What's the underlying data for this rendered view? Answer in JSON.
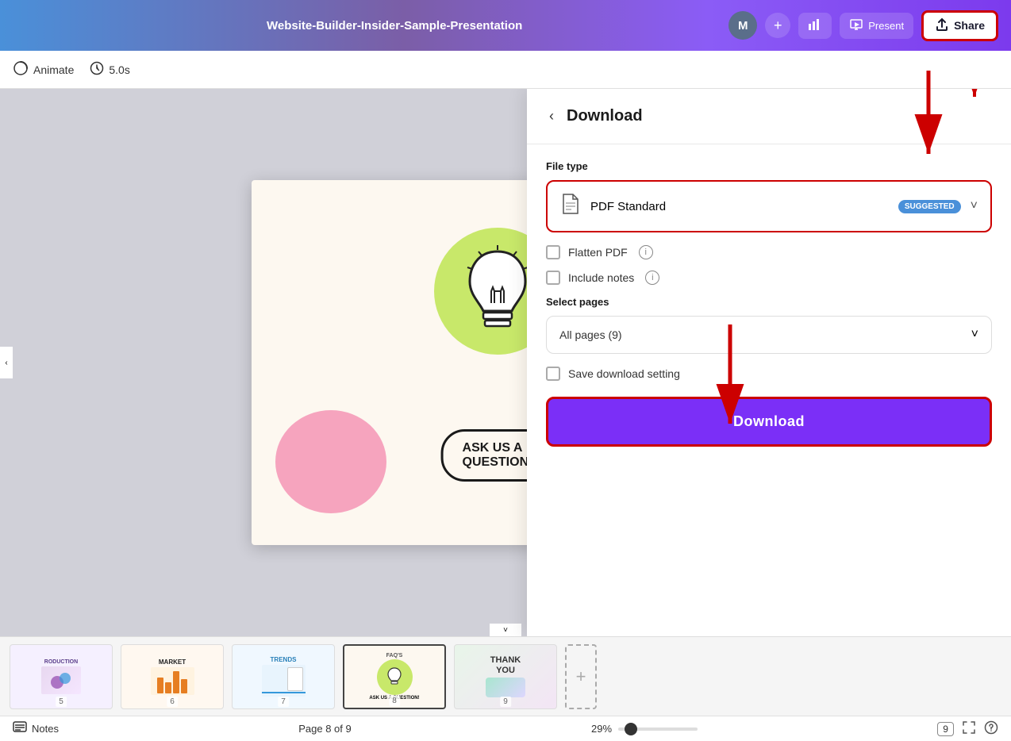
{
  "topbar": {
    "title": "Website-Builder-Insider-Sample-Presentation",
    "avatar_letter": "M",
    "present_label": "Present",
    "share_label": "Share",
    "analytics_icon": "chart-icon",
    "present_icon": "present-icon"
  },
  "toolbar": {
    "animate_label": "Animate",
    "duration_label": "5.0s"
  },
  "download_panel": {
    "back_label": "‹",
    "title": "Download",
    "file_type_label": "File type",
    "file_type_value": "PDF Standard",
    "suggested_label": "SUGGESTED",
    "flatten_pdf_label": "Flatten PDF",
    "include_notes_label": "Include notes",
    "select_pages_label": "Select pages",
    "all_pages_value": "All pages (9)",
    "save_setting_label": "Save download setting",
    "download_btn_label": "Download"
  },
  "slide": {
    "ask_text": "ASK US A\nQUESTION!"
  },
  "bottom_bar": {
    "notes_label": "Notes",
    "page_info": "Page 8 of 9",
    "zoom_pct": "29%",
    "page_count": "9"
  },
  "thumbnails": [
    {
      "num": "5",
      "type": "production"
    },
    {
      "num": "6",
      "type": "market"
    },
    {
      "num": "7",
      "type": "trends"
    },
    {
      "num": "8",
      "type": "faq",
      "active": true
    },
    {
      "num": "9",
      "type": "thankyou"
    }
  ]
}
